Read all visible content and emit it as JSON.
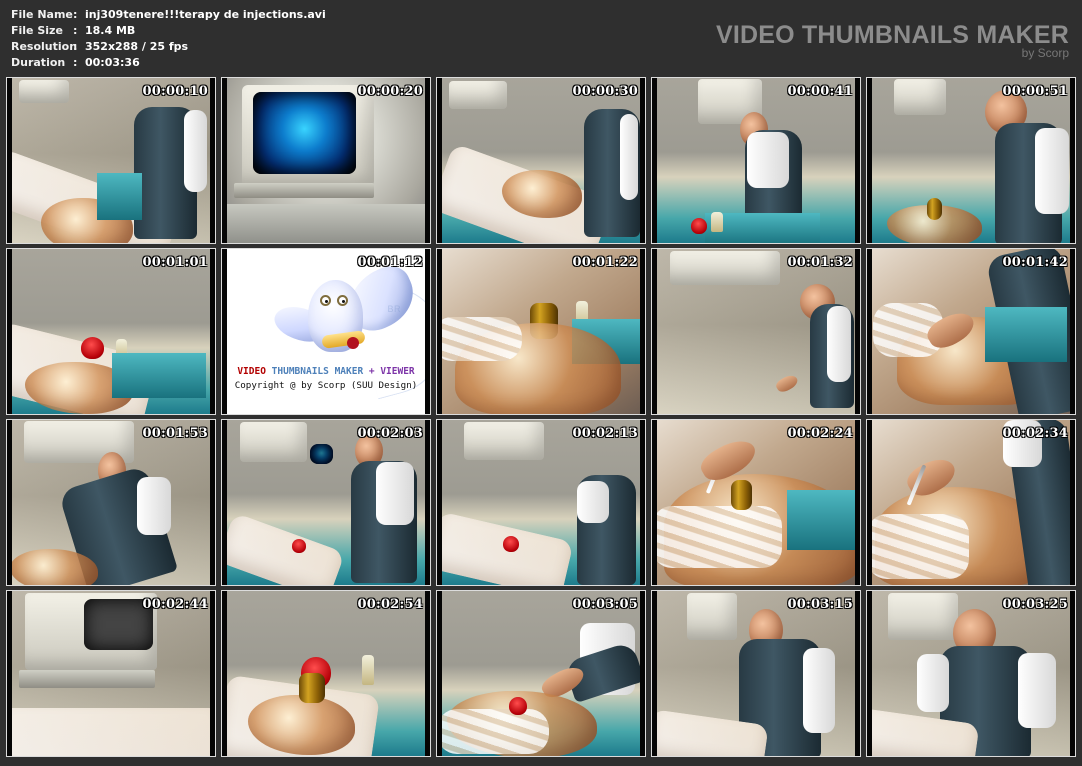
{
  "info": {
    "rows": [
      {
        "label": "File Name",
        "separator": ":",
        "value": "inj309tenere!!!terapy de injections.avi"
      },
      {
        "label": "File Size",
        "separator": ":",
        "value": "18.4 MB"
      },
      {
        "label": "Resolution",
        "separator": ":",
        "value": "352x288 / 25 fps"
      },
      {
        "label": "Duration",
        "separator": ":",
        "value": "00:03:36"
      }
    ]
  },
  "brand": {
    "title": "VIDEO THUMBNAILS MAKER",
    "by": "by Scorp"
  },
  "thumbnails": [
    {
      "time": "00:00:10",
      "scene": "patient-doctor"
    },
    {
      "time": "00:00:20",
      "scene": "monitor"
    },
    {
      "time": "00:00:30",
      "scene": "patient-table"
    },
    {
      "time": "00:00:41",
      "scene": "doctor-standing"
    },
    {
      "time": "00:00:51",
      "scene": "doctor-portrait"
    },
    {
      "time": "00:01:01",
      "scene": "patient-red-cup"
    },
    {
      "time": "00:01:12",
      "scene": "logo"
    },
    {
      "time": "00:01:22",
      "scene": "patient-closeup"
    },
    {
      "time": "00:01:32",
      "scene": "doctor-side"
    },
    {
      "time": "00:01:42",
      "scene": "hand-closeup"
    },
    {
      "time": "00:01:53",
      "scene": "doctor-bending"
    },
    {
      "time": "00:02:03",
      "scene": "doctor-right"
    },
    {
      "time": "00:02:13",
      "scene": "doctor-back"
    },
    {
      "time": "00:02:24",
      "scene": "syringe-closeup"
    },
    {
      "time": "00:02:34",
      "scene": "hand-syringe"
    },
    {
      "time": "00:02:44",
      "scene": "monitor-patient"
    },
    {
      "time": "00:02:54",
      "scene": "patient-low"
    },
    {
      "time": "00:03:05",
      "scene": "patient-edge"
    },
    {
      "time": "00:03:15",
      "scene": "doctor-front"
    },
    {
      "time": "00:03:25",
      "scene": "doctor-front-alt"
    }
  ],
  "logo": {
    "line1_part1": "VIDEO",
    "line1_part2": " THUMBNAILS MAKER",
    "line1_part3": " + VIEWER",
    "line2": "Copyright @ by Scorp (SUU Design)",
    "faint_text": "BR"
  },
  "colors": {
    "background": "#2f2f2f",
    "header_text": "#f0f0f0",
    "brand_text": "#8c8c8c",
    "thumbnail_border": "#dcdcdc",
    "timestamp_text": "#ffffff"
  },
  "icons": {
    "logo": "owl-icon"
  }
}
